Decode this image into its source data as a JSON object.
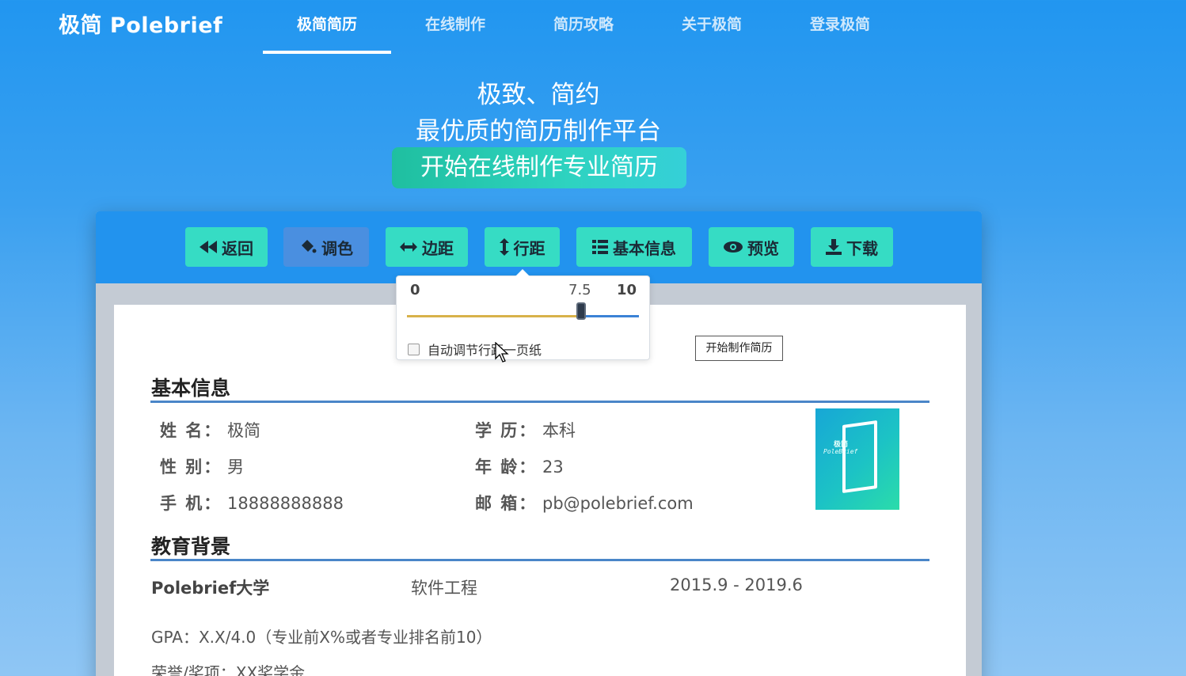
{
  "app": {
    "logo": "极简 Polebrief"
  },
  "nav": {
    "items": [
      {
        "label": "极简简历",
        "active": true
      },
      {
        "label": "在线制作"
      },
      {
        "label": "简历攻略"
      },
      {
        "label": "关于极简"
      },
      {
        "label": "登录极简"
      }
    ]
  },
  "hero": {
    "line1": "极致、简约",
    "line2": "最优质的简历制作平台",
    "cta": "开始在线制作专业简历"
  },
  "toolbar": {
    "back": "返回",
    "color": "调色",
    "margin": "边距",
    "line_spacing": "行距",
    "basic_info": "基本信息",
    "preview": "预览",
    "download": "下载"
  },
  "line_spacing_popover": {
    "min_label": "0",
    "current_label": "7.5",
    "max_label": "10",
    "min": 0,
    "max": 10,
    "value": 7.5,
    "auto_label": "自动调节行距一页纸",
    "auto_checked": false
  },
  "tooltip": {
    "text": "开始制作简历"
  },
  "resume": {
    "basic_title": "基本信息",
    "fields": {
      "name_label": "姓 名：",
      "name": "极简",
      "gender_label": "性 别：",
      "gender": "男",
      "phone_label": "手 机：",
      "phone": "18888888888",
      "degree_label": "学 历：",
      "degree": "本科",
      "age_label": "年 龄：",
      "age": "23",
      "email_label": "邮 箱：",
      "email": "pb@polebrief.com"
    },
    "photo": {
      "brand_cn": "极简",
      "brand_en": "PoleBrief"
    },
    "education_title": "教育背景",
    "education": {
      "school": "Polebrief大学",
      "major": "软件工程",
      "period": "2015.9 - 2019.6",
      "gpa": "GPA：X.X/4.0（专业前X%或者专业排名前10）",
      "honors": "荣誉/奖项：XX奖学金"
    }
  },
  "colors": {
    "header_bg": "#2196f0",
    "accent_teal": "#36dcc4",
    "section_rule": "#4a86c8"
  }
}
